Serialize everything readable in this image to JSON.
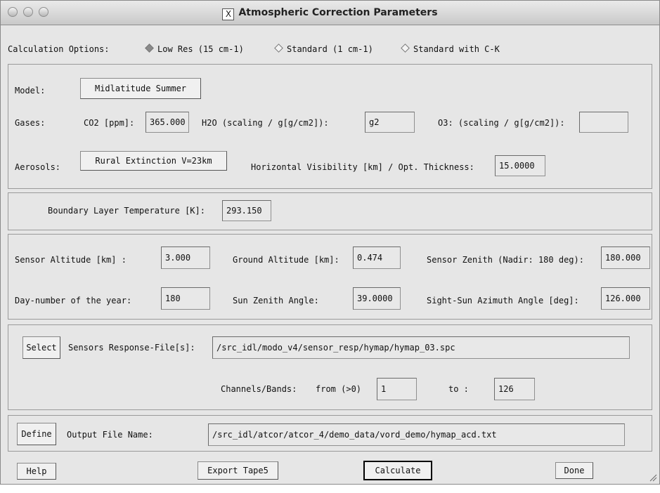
{
  "window": {
    "title": "Atmospheric Correction Parameters",
    "title_icon": "X"
  },
  "calc": {
    "label": "Calculation Options:",
    "options": [
      "Low Res (15 cm-1)",
      "Standard (1 cm-1)",
      "Standard with C-K"
    ],
    "selected": "Low Res (15 cm-1)"
  },
  "model": {
    "label": "Model:",
    "button": "Midlatitude Summer"
  },
  "gases": {
    "label": "Gases:",
    "co2_label": "CO2 [ppm]:",
    "co2_value": "365.000",
    "h2o_label": "H2O (scaling / g[g/cm2]):",
    "h2o_value": "g2",
    "o3_label": "O3: (scaling / g[g/cm2]):",
    "o3_value": ""
  },
  "aerosols": {
    "label": "Aerosols:",
    "button": "Rural Extinction  V=23km",
    "vis_label": "Horizontal Visibility [km] / Opt. Thickness:",
    "vis_value": "15.0000"
  },
  "boundary": {
    "label": "Boundary Layer Temperature [K]:",
    "value": "293.150"
  },
  "geometry": {
    "sensor_alt_label": "Sensor Altitude [km] :",
    "sensor_alt_value": "3.000",
    "ground_alt_label": "Ground Altitude [km]:",
    "ground_alt_value": "0.474",
    "sensor_zenith_label": "Sensor Zenith (Nadir: 180 deg):",
    "sensor_zenith_value": "180.000",
    "day_label": "Day-number of the year:",
    "day_value": "180",
    "sun_zenith_label": "Sun Zenith Angle:",
    "sun_zenith_value": "39.0000",
    "azimuth_label": "Sight-Sun Azimuth Angle [deg]:",
    "azimuth_value": "126.000"
  },
  "sensor": {
    "select_button": "Select",
    "file_label": "Sensors Response-File[s]:",
    "file_value": "/src_idl/modo_v4/sensor_resp/hymap/hymap_03.spc",
    "channels_label": "Channels/Bands:",
    "from_label": "from (>0)",
    "from_value": "1",
    "to_label": "to :",
    "to_value": "126"
  },
  "output": {
    "define_button": "Define",
    "label": "Output File Name:",
    "value": "/src_idl/atcor/atcor_4/demo_data/vord_demo/hymap_acd.txt"
  },
  "footer": {
    "help": "Help",
    "export": "Export Tape5",
    "calculate": "Calculate",
    "done": "Done"
  }
}
